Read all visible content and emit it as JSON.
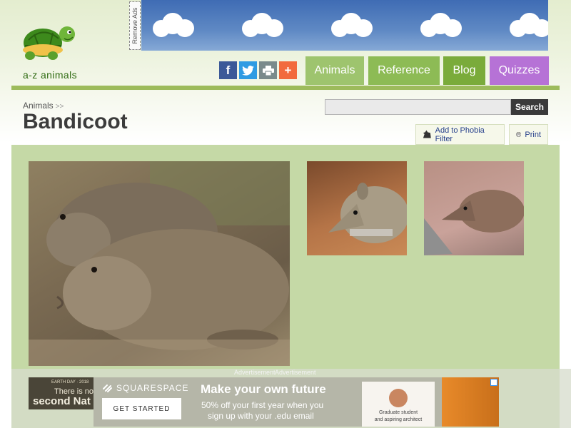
{
  "brand": {
    "name": "a-z animals"
  },
  "ads": {
    "remove_ads": "Remove Ads",
    "label": "Advertisement",
    "earthday": {
      "line1": "EARTH DAY · 2018",
      "line2": "There is no",
      "line3": "second Nat"
    },
    "squarespace": {
      "brand": "SQUARESPACE",
      "cta": "GET STARTED",
      "headline": "Make your own future",
      "body_line1": "50% off your first year when you",
      "body_line2": "sign up with your .edu email",
      "card_line1": "Graduate student",
      "card_line2": "and aspiring architect"
    }
  },
  "share": {
    "facebook": "f",
    "plus": "+"
  },
  "nav": [
    {
      "label": "Animals",
      "color": "#9ec46e"
    },
    {
      "label": "Reference",
      "color": "#8dbb55"
    },
    {
      "label": "Blog",
      "color": "#7aab3a"
    },
    {
      "label": "Quizzes",
      "color": "#b672d6"
    }
  ],
  "breadcrumb": {
    "label": "Animals",
    "sep": ">>"
  },
  "page": {
    "title": "Bandicoot"
  },
  "search": {
    "placeholder": "",
    "button": "Search"
  },
  "tools": {
    "phobia": "Add to Phobia Filter",
    "print": "Print"
  },
  "colors": {
    "accent_green": "#9dbb5c",
    "content_bg": "#c5d9a6",
    "logo_green": "#2f6b12"
  }
}
